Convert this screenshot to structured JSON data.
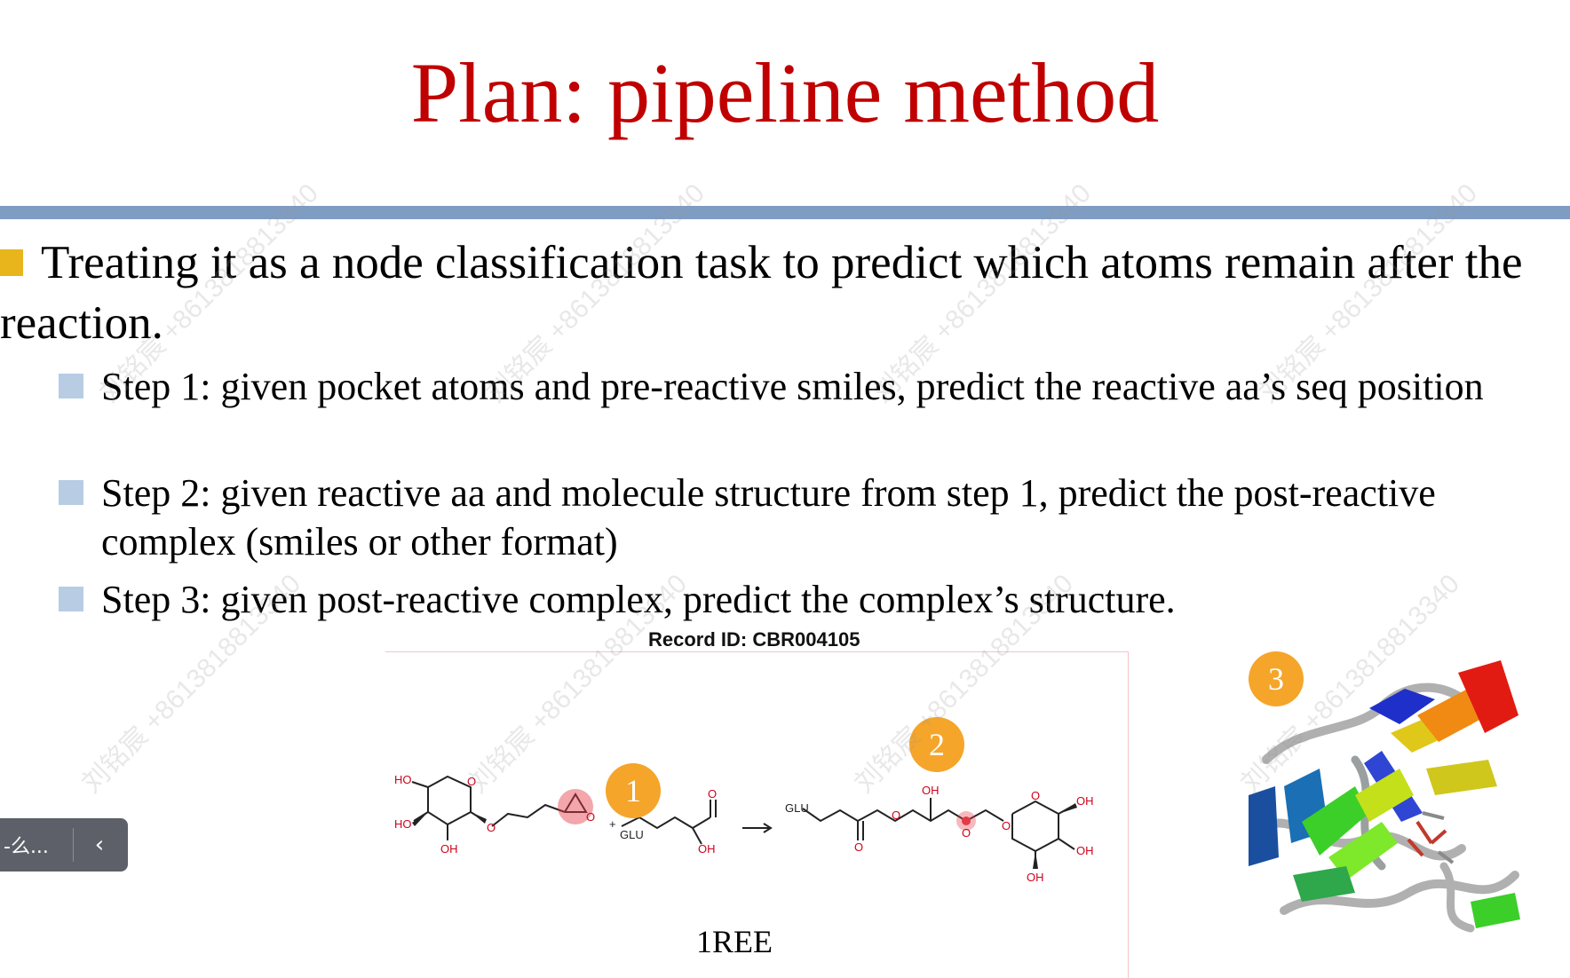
{
  "slide": {
    "title": "Plan: pipeline method",
    "main_bullet": "Treating it as a node classification task to predict which atoms remain after the reaction.",
    "steps": [
      "Step 1: given pocket atoms and pre-reactive smiles, predict the reactive aa’s seq position",
      "Step 2: given reactive aa and molecule structure from step 1, predict the post-reactive complex (smiles or other format)",
      "Step 3: given post-reactive complex, predict the complex’s structure."
    ],
    "record_id": "Record ID: CBR004105",
    "pdb_label": "1REE",
    "badges": [
      "1",
      "2",
      "3"
    ],
    "molecule_labels": {
      "ho_top": "HO",
      "ho_left": "HO",
      "oh_bottom_left": "OH",
      "o_ring_1": "O",
      "o_link_1": "O",
      "o_epoxide": "O",
      "plus": "+",
      "glu_1": "GLU",
      "o_acid": "O",
      "oh_acid": "OH",
      "glu_2": "GLU",
      "o_ester_eq": "O",
      "o_ester": "O",
      "oh_top_mid": "OH",
      "o_reactive": "O",
      "o_link_2": "O",
      "o_ring_2": "O",
      "oh_right_top": "OH",
      "oh_right_bottom": "OH",
      "oh_bottom_right": "OH"
    },
    "colors": {
      "title": "#c00000",
      "rule": "#7f9cc2",
      "main_square": "#e8b51c",
      "sub_square": "#b8cce4",
      "badge": "#f5a52a",
      "highlight": "#e53945"
    }
  },
  "watermark": {
    "text": "刘铭宸 +8613818813340"
  },
  "toolbar": {
    "text": "-么...",
    "collapse_icon": "chevron-left-icon",
    "collapse_glyph": "‹"
  }
}
